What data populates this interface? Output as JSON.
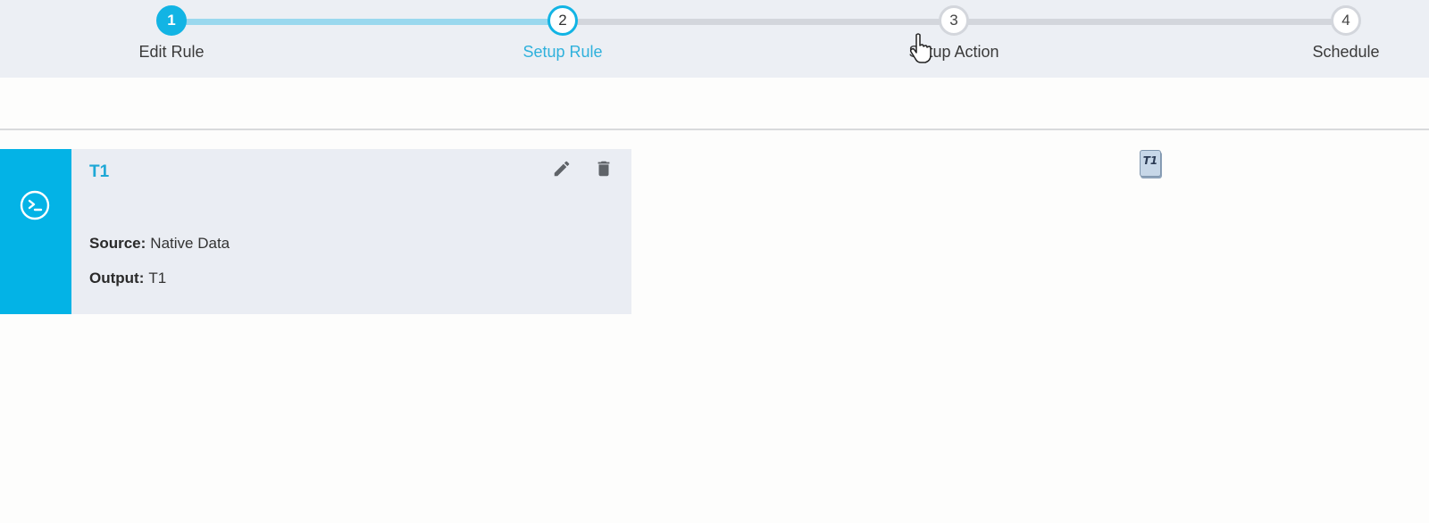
{
  "stepper": {
    "steps": [
      {
        "number": "1",
        "label": "Edit Rule",
        "state": "complete"
      },
      {
        "number": "2",
        "label": "Setup Rule",
        "state": "current"
      },
      {
        "number": "3",
        "label": "Setup Action",
        "state": "todo"
      },
      {
        "number": "4",
        "label": "Schedule",
        "state": "todo"
      }
    ]
  },
  "rule_card": {
    "title": "T1",
    "icon": "terminal-circle-icon",
    "source_label": "Source:",
    "source_value": "Native Data",
    "output_label": "Output:",
    "output_value": "T1"
  },
  "floating_chip": {
    "label": "T1"
  },
  "colors": {
    "accent": "#03b3e6",
    "stepper_bg": "#eceff4",
    "card_bg": "#eaedf3",
    "track_done": "#9ad8ee",
    "track_todo": "#d3d6dc"
  }
}
